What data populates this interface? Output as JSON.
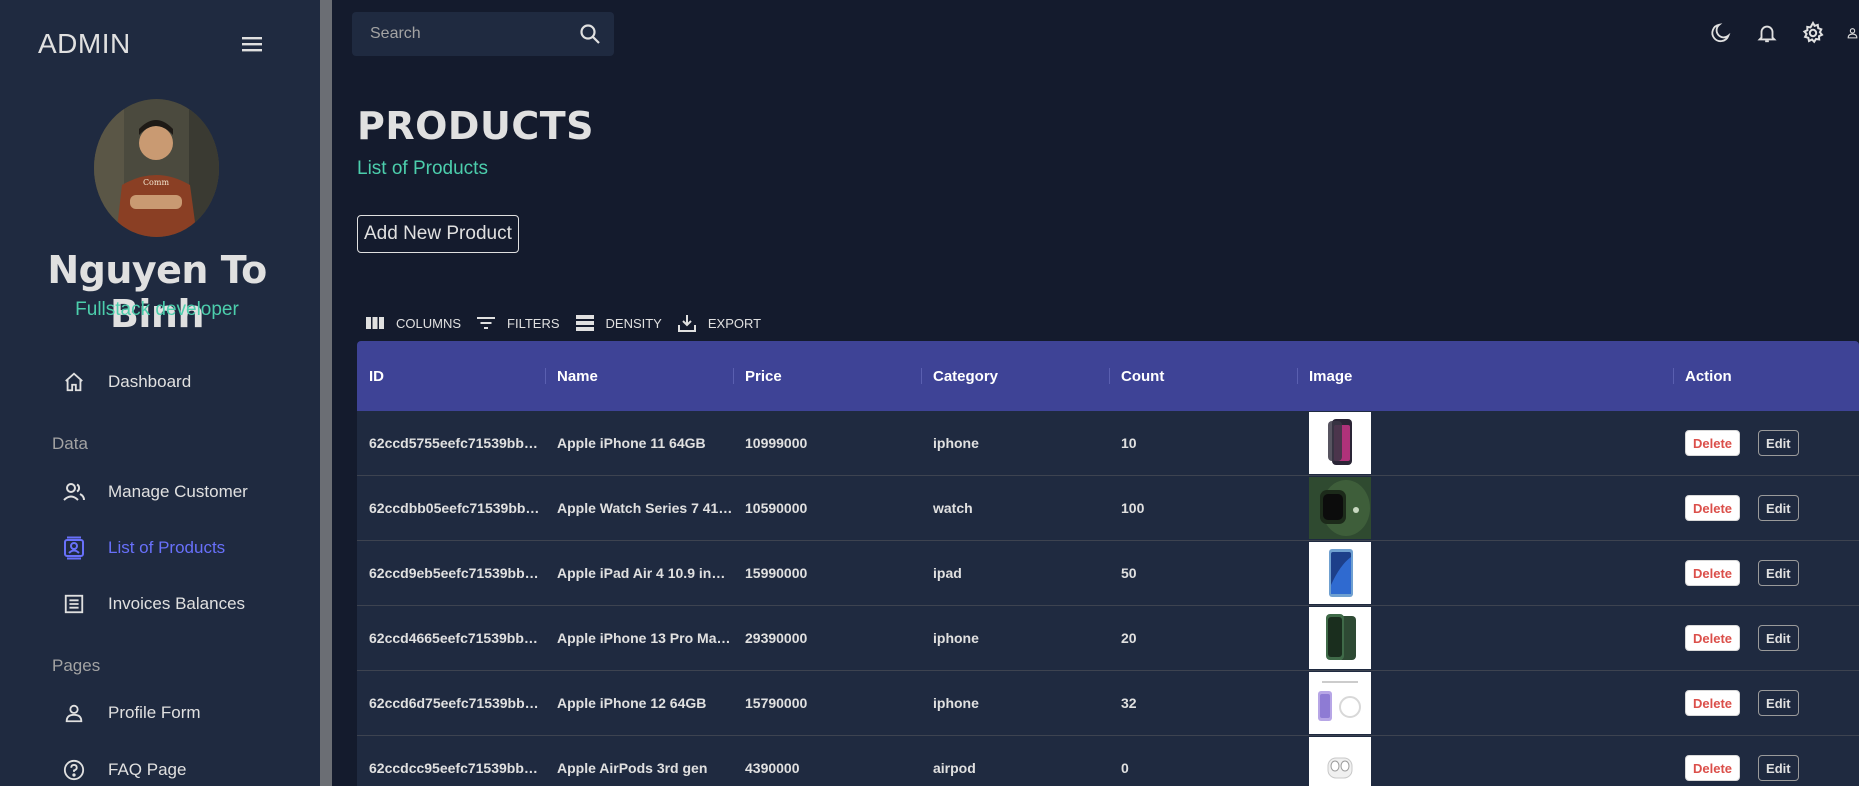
{
  "sidebar": {
    "brand": "ADMIN",
    "user": {
      "name": "Nguyen To Binh",
      "role": "Fullstack developer"
    },
    "items": [
      {
        "label": "Dashboard",
        "icon": "home-icon"
      },
      {
        "label": "Manage Customer",
        "icon": "people-icon"
      },
      {
        "label": "List of Products",
        "icon": "contacts-icon",
        "active": true
      },
      {
        "label": "Invoices Balances",
        "icon": "receipt-icon"
      },
      {
        "label": "Profile Form",
        "icon": "person-icon"
      },
      {
        "label": "FAQ Page",
        "icon": "help-icon"
      }
    ],
    "sections": {
      "data": "Data",
      "pages": "Pages"
    }
  },
  "topbar": {
    "search_placeholder": "Search",
    "icons": [
      "moon-icon",
      "bell-icon",
      "gear-icon",
      "person-icon"
    ]
  },
  "header": {
    "title": "PRODUCTS",
    "subtitle": "List of Products",
    "add_button": "Add New Product"
  },
  "toolbar": {
    "columns": "COLUMNS",
    "filters": "FILTERS",
    "density": "DENSITY",
    "export": "EXPORT"
  },
  "table": {
    "columns": [
      "ID",
      "Name",
      "Price",
      "Category",
      "Count",
      "Image",
      "Action"
    ],
    "rows": [
      {
        "id": "62ccd5755eefc71539bb…",
        "name": "Apple iPhone 11 64GB",
        "price": "10999000",
        "category": "iphone",
        "count": "10",
        "image": "iphone-11-image"
      },
      {
        "id": "62ccdbb05eefc71539bb…",
        "name": "Apple Watch Series 7 41…",
        "price": "10590000",
        "category": "watch",
        "count": "100",
        "image": "watch-image"
      },
      {
        "id": "62ccd9eb5eefc71539bb…",
        "name": "Apple iPad Air 4 10.9 inc…",
        "price": "15990000",
        "category": "ipad",
        "count": "50",
        "image": "ipad-image"
      },
      {
        "id": "62ccd4665eefc71539bb…",
        "name": "Apple iPhone 13 Pro Ma…",
        "price": "29390000",
        "category": "iphone",
        "count": "20",
        "image": "iphone-13-image"
      },
      {
        "id": "62ccd6d75eefc71539bb…",
        "name": "Apple iPhone 12 64GB",
        "price": "15790000",
        "category": "iphone",
        "count": "32",
        "image": "iphone-12-image"
      },
      {
        "id": "62ccdcc95eefc71539bb…",
        "name": "Apple AirPods 3rd gen",
        "price": "4390000",
        "category": "airpod",
        "count": "0",
        "image": "airpods-image"
      }
    ],
    "delete_label": "Delete",
    "edit_label": "Edit"
  },
  "colors": {
    "accent": "#4cceac",
    "header": "#3e4396",
    "active": "#6870fa",
    "danger": "#db4f4a"
  }
}
